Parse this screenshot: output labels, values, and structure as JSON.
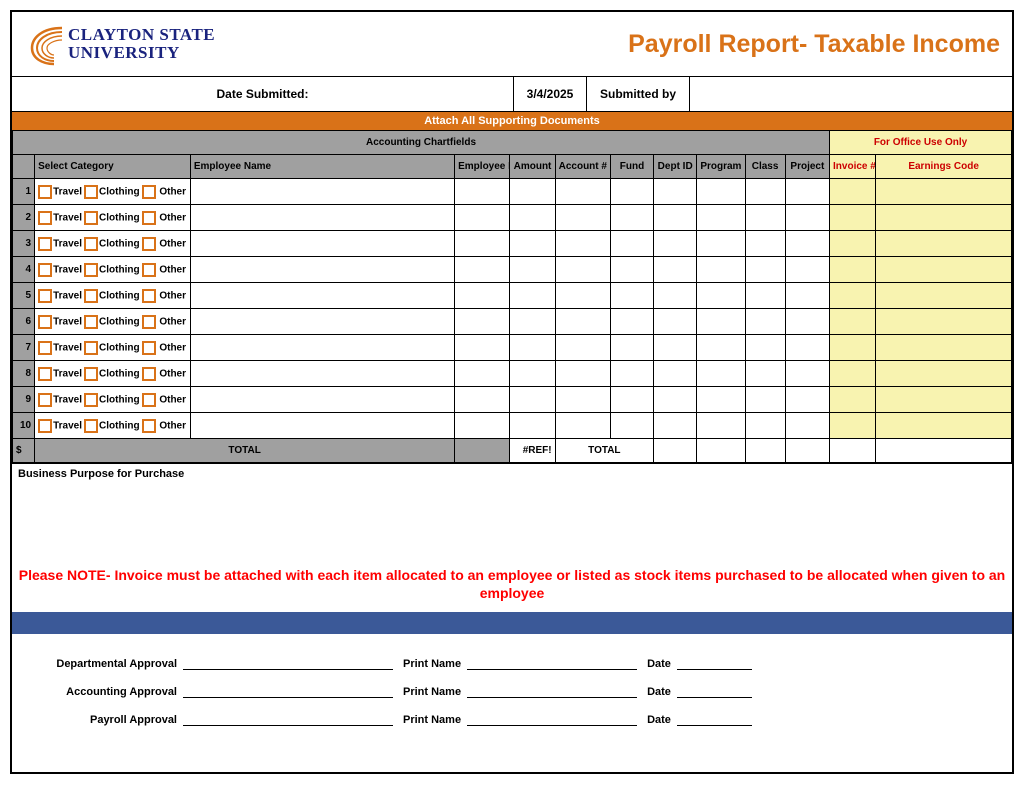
{
  "logo": {
    "line1": "CLAYTON STATE",
    "line2": "UNIVERSITY"
  },
  "title": "Payroll Report- Taxable Income",
  "meta": {
    "date_label": "Date Submitted:",
    "date_value": "3/4/2025",
    "submitted_by_label": "Submitted by",
    "submitted_by_value": ""
  },
  "banner": "Attach All Supporting Documents",
  "sections": {
    "accounting": "Accounting Chartfields",
    "office": "For Office Use Only"
  },
  "columns": {
    "select_category": "Select Category",
    "employee_name": "Employee Name",
    "employee_id": "Employee ID",
    "amount": "Amount",
    "account": "Account #",
    "fund": "Fund",
    "dept_id": "Dept ID",
    "program": "Program",
    "class": "Class",
    "project": "Project",
    "invoice": "Invoice #",
    "earnings_code": "Earnings Code"
  },
  "category_options": {
    "travel": "Travel",
    "clothing": "Clothing",
    "other": "Other"
  },
  "rows": [
    {
      "num": "1"
    },
    {
      "num": "2"
    },
    {
      "num": "3"
    },
    {
      "num": "4"
    },
    {
      "num": "5"
    },
    {
      "num": "6"
    },
    {
      "num": "7"
    },
    {
      "num": "8"
    },
    {
      "num": "9"
    },
    {
      "num": "10"
    }
  ],
  "totals": {
    "currency": "$",
    "total_label": "TOTAL",
    "ref_error": "#REF!",
    "total_label2": "TOTAL"
  },
  "purpose_label": "Business Purpose for Purchase",
  "note": "Please NOTE- Invoice must be attached with each item allocated to an employee or listed as stock items purchased to be allocated when given to an employee",
  "approvals": {
    "departmental": "Departmental Approval",
    "accounting": "Accounting Approval",
    "payroll": "Payroll Approval",
    "print_name": "Print Name",
    "date": "Date"
  }
}
